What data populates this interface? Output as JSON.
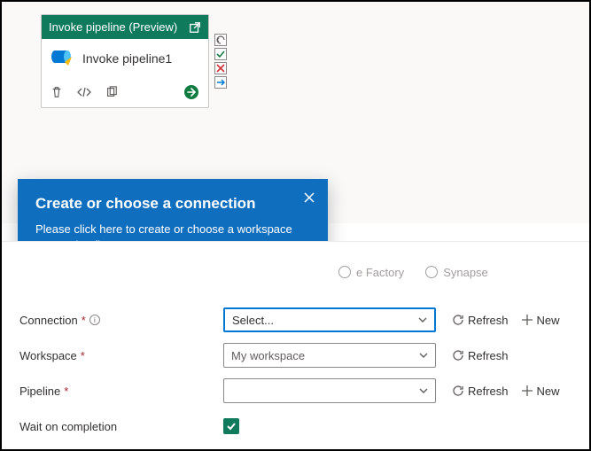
{
  "activity": {
    "header": "Invoke pipeline (Preview)",
    "name": "Invoke pipeline1"
  },
  "callout": {
    "title": "Create or choose a connection",
    "body": "Please click here to create or choose a workspace connection first."
  },
  "radios": {
    "factory": "e Factory",
    "synapse": "Synapse"
  },
  "form": {
    "connection_label": "Connection",
    "connection_value": "Select...",
    "workspace_label": "Workspace",
    "workspace_value": "My workspace",
    "pipeline_label": "Pipeline",
    "pipeline_value": "",
    "wait_label": "Wait on completion"
  },
  "actions": {
    "refresh": "Refresh",
    "new": "New"
  }
}
